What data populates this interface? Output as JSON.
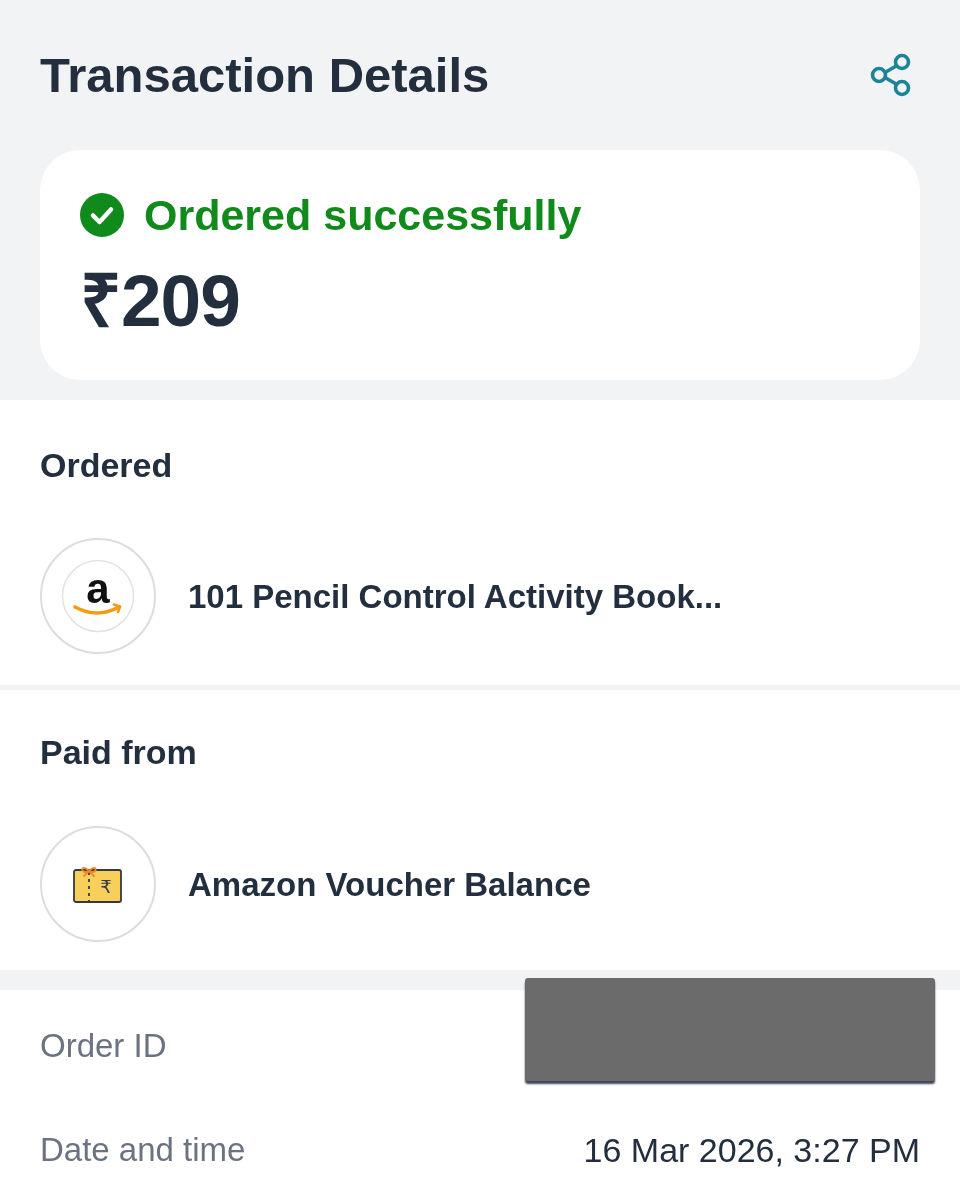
{
  "header": {
    "title": "Transaction Details"
  },
  "status": {
    "kind": "success",
    "label": "Ordered successfully",
    "amount": "₹209"
  },
  "sections": [
    {
      "heading": "Ordered",
      "item": {
        "kind": "store",
        "glyph": "a",
        "label": "101 Pencil Control Activity Book..."
      }
    },
    {
      "heading": "Paid from",
      "item": {
        "kind": "voucher",
        "glyph": "₹",
        "label": "Amazon Voucher Balance"
      }
    }
  ],
  "details": [
    {
      "label": "Order ID",
      "redacted": true
    },
    {
      "label": "Date and time",
      "value": "16 Mar 2026, 3:27 PM",
      "redacted": false
    }
  ]
}
